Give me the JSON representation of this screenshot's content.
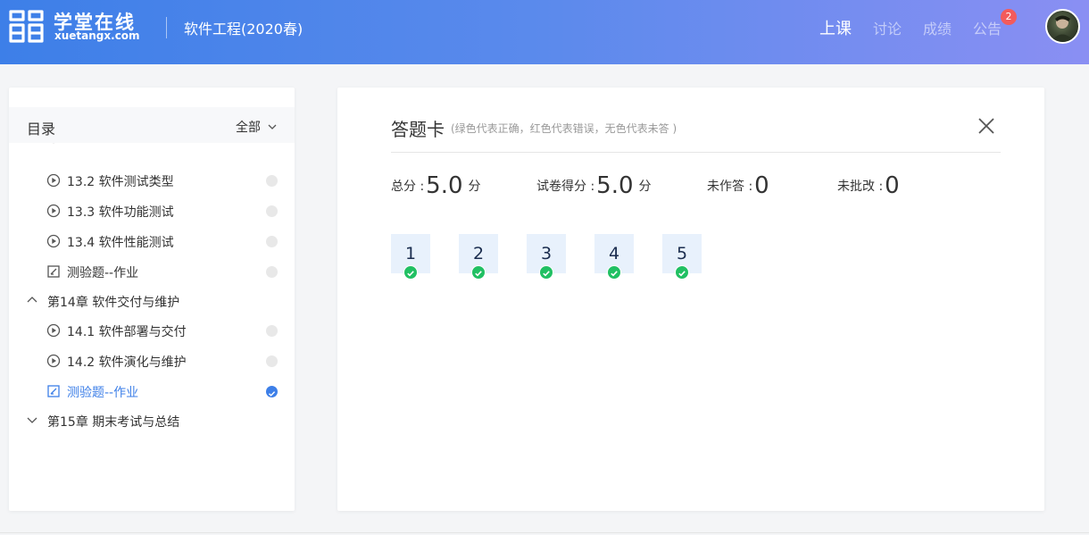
{
  "header": {
    "brand_cn": "学堂在线",
    "brand_en": "xuetangx.com",
    "course_title": "软件工程(2020春)",
    "nav": [
      {
        "label": "上课",
        "active": true
      },
      {
        "label": "讨论",
        "active": false
      },
      {
        "label": "成绩",
        "active": false
      },
      {
        "label": "公告",
        "active": false
      }
    ],
    "notice_badge": "2",
    "accent_color": "#3d7fe8"
  },
  "sidebar": {
    "title": "目录",
    "filter_label": "全部",
    "items": [
      {
        "kind": "video",
        "label": "13.2 软件测试类型",
        "status": "none"
      },
      {
        "kind": "video",
        "label": "13.3 软件功能测试",
        "status": "none"
      },
      {
        "kind": "video",
        "label": "13.4 软件性能测试",
        "status": "none"
      },
      {
        "kind": "quiz",
        "label": "测验题--作业",
        "status": "none"
      },
      {
        "kind": "chapter",
        "label": "第14章 软件交付与维护",
        "expanded": true
      },
      {
        "kind": "video",
        "label": "14.1 软件部署与交付",
        "status": "none"
      },
      {
        "kind": "video",
        "label": "14.2 软件演化与维护",
        "status": "none"
      },
      {
        "kind": "quiz",
        "label": "测验题--作业",
        "status": "done",
        "current": true
      },
      {
        "kind": "chapter",
        "label": "第15章 期末考试与总结",
        "expanded": false
      }
    ]
  },
  "answer_card": {
    "title": "答题卡",
    "hint": "(绿色代表正确，红色代表错误，无色代表未答 )",
    "stats": {
      "total_label": "总分 :",
      "total_value": "5.0",
      "total_unit": "分",
      "score_label": "试卷得分 :",
      "score_value": "5.0",
      "score_unit": "分",
      "unanswered_label": "未作答 :",
      "unanswered_value": "0",
      "ungraded_label": "未批改 :",
      "ungraded_value": "0"
    },
    "questions": [
      {
        "num": "1",
        "result": "correct"
      },
      {
        "num": "2",
        "result": "correct"
      },
      {
        "num": "3",
        "result": "correct"
      },
      {
        "num": "4",
        "result": "correct"
      },
      {
        "num": "5",
        "result": "correct"
      }
    ],
    "correct_color": "#21c063"
  }
}
